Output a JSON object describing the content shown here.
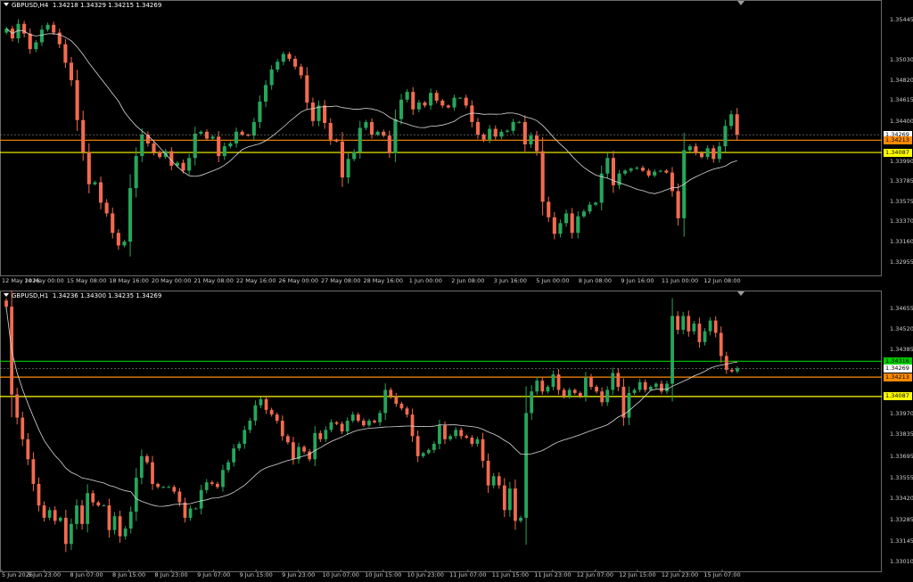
{
  "top_chart": {
    "title": "GBPUSD,H4",
    "ohlc": "1.34218 1.34329 1.34215 1.34269",
    "price_labels": [
      "1.35445",
      "1.35030",
      "1.34820",
      "1.34615",
      "1.34400",
      "1.33990",
      "1.33785",
      "1.33575",
      "1.33370",
      "1.33160",
      "1.32955"
    ],
    "time_labels": [
      "12 May 2026",
      "14 May 00:00",
      "15 May 08:00",
      "18 May 16:00",
      "20 May 00:00",
      "21 May 08:00",
      "22 May 16:00",
      "26 May 00:00",
      "27 May 08:00",
      "28 May 16:00",
      "1 Jun 00:00",
      "2 Jun 08:00",
      "3 Jun 16:00",
      "5 Jun 00:00",
      "8 Jun 08:00",
      "9 Jun 16:00",
      "11 Jun 00:00",
      "12 Jun 08:00"
    ],
    "tags": [
      {
        "value": "1.34269",
        "color": "#ffffff"
      },
      {
        "value": "1.34213",
        "color": "#ff8c00"
      },
      {
        "value": "1.34087",
        "color": "#ffff00"
      }
    ],
    "price_range": [
      1.3285,
      1.356
    ]
  },
  "bottom_chart": {
    "title": "GBPUSD,H1",
    "ohlc": "1.34236 1.34300 1.34235 1.34269",
    "price_labels": [
      "1.34655",
      "1.34520",
      "1.34385",
      "1.33970",
      "1.33835",
      "1.33695",
      "1.33555",
      "1.33420",
      "1.33285",
      "1.33145",
      "1.33010"
    ],
    "time_labels": [
      "5 Jun 2026",
      "5 Jun 23:00",
      "8 Jun 07:00",
      "8 Jun 15:00",
      "8 Jun 23:00",
      "9 Jun 07:00",
      "9 Jun 15:00",
      "9 Jun 23:00",
      "10 Jun 07:00",
      "10 Jun 15:00",
      "10 Jun 23:00",
      "11 Jun 07:00",
      "11 Jun 15:00",
      "11 Jun 23:00",
      "12 Jun 07:00",
      "12 Jun 15:00",
      "12 Jun 23:00",
      "15 Jun 07:00"
    ],
    "tags": [
      {
        "value": "1.34316",
        "color": "#00cc00"
      },
      {
        "value": "1.34269",
        "color": "#ffffff"
      },
      {
        "value": "1.34213",
        "color": "#ff8c00"
      },
      {
        "value": "1.34087",
        "color": "#ffff00"
      }
    ],
    "price_range": [
      1.3297,
      1.3474
    ]
  },
  "colors": {
    "bull": "#26a65b",
    "bear": "#f26b50",
    "ma": "#d8d8d8",
    "orange_line": "#ff8c00",
    "yellow_line": "#ffff00",
    "green_line": "#00cc00",
    "grid_border": "#6b6b6b"
  },
  "chart_data": [
    {
      "type": "candlestick",
      "title": "GBPUSD,H4",
      "ylim": [
        1.3285,
        1.356
      ],
      "series": [
        {
          "name": "GBPUSD,H4",
          "values": [
            1.3536,
            1.3526,
            1.3541,
            1.3531,
            1.3515,
            1.3522,
            1.3535,
            1.354,
            1.3532,
            1.352,
            1.3501,
            1.3483,
            1.3442,
            1.3409,
            1.3376,
            1.3378,
            1.3357,
            1.3346,
            1.3326,
            1.3313,
            1.3317,
            1.3372,
            1.3405,
            1.3427,
            1.3418,
            1.3409,
            1.3404,
            1.341,
            1.3395,
            1.3398,
            1.339,
            1.3403,
            1.3428,
            1.343,
            1.3423,
            1.3425,
            1.3405,
            1.3415,
            1.3418,
            1.343,
            1.3427,
            1.3426,
            1.344,
            1.3461,
            1.3478,
            1.3494,
            1.3502,
            1.351,
            1.3505,
            1.3497,
            1.3488,
            1.346,
            1.3441,
            1.3457,
            1.3439,
            1.3422,
            1.342,
            1.3383,
            1.3402,
            1.3409,
            1.3434,
            1.344,
            1.3427,
            1.343,
            1.3426,
            1.3408,
            1.3443,
            1.3463,
            1.3471,
            1.3453,
            1.346,
            1.3457,
            1.347,
            1.3462,
            1.3457,
            1.3455,
            1.3465,
            1.3465,
            1.3457,
            1.344,
            1.3427,
            1.3422,
            1.3433,
            1.3425,
            1.343,
            1.3431,
            1.344,
            1.344,
            1.3417,
            1.3426,
            1.341,
            1.3358,
            1.3342,
            1.3325,
            1.3336,
            1.3346,
            1.3326,
            1.3343,
            1.3348,
            1.3355,
            1.3357,
            1.3387,
            1.3403,
            1.3375,
            1.3387,
            1.339,
            1.3392,
            1.3393,
            1.339,
            1.3385,
            1.3389,
            1.339,
            1.3388,
            1.3369,
            1.3341,
            1.3411,
            1.3415,
            1.3408,
            1.3404,
            1.3413,
            1.3402,
            1.3415,
            1.3436,
            1.3448,
            1.3427
          ]
        }
      ],
      "reference_lines": [
        1.34213,
        1.34087
      ],
      "last_price": 1.34269
    },
    {
      "type": "candlestick",
      "title": "GBPUSD,H1",
      "ylim": [
        1.3297,
        1.3474
      ],
      "series": [
        {
          "name": "GBPUSD,H1",
          "values": [
            1.3467,
            1.341,
            1.3395,
            1.3381,
            1.3368,
            1.3352,
            1.3338,
            1.333,
            1.3335,
            1.3328,
            1.333,
            1.3313,
            1.3326,
            1.3338,
            1.3326,
            1.3346,
            1.334,
            1.3338,
            1.3338,
            1.3322,
            1.3331,
            1.3318,
            1.3323,
            1.3334,
            1.3356,
            1.337,
            1.3366,
            1.3352,
            1.335,
            1.335,
            1.335,
            1.3347,
            1.334,
            1.333,
            1.3336,
            1.3336,
            1.3348,
            1.3353,
            1.3352,
            1.335,
            1.3361,
            1.3366,
            1.3375,
            1.3378,
            1.3387,
            1.3393,
            1.3403,
            1.3407,
            1.34,
            1.3397,
            1.3393,
            1.3383,
            1.3379,
            1.3368,
            1.3376,
            1.3373,
            1.3368,
            1.3385,
            1.3381,
            1.3387,
            1.3392,
            1.3391,
            1.3386,
            1.3393,
            1.3397,
            1.3393,
            1.339,
            1.3393,
            1.3392,
            1.3398,
            1.3413,
            1.3409,
            1.3404,
            1.3401,
            1.3397,
            1.3383,
            1.337,
            1.3372,
            1.3374,
            1.3378,
            1.339,
            1.3381,
            1.3383,
            1.3387,
            1.3383,
            1.3382,
            1.3378,
            1.3381,
            1.3367,
            1.3351,
            1.3357,
            1.3351,
            1.3335,
            1.3349,
            1.3328,
            1.333,
            1.3398,
            1.3412,
            1.3419,
            1.3412,
            1.3415,
            1.3423,
            1.3413,
            1.3409,
            1.3413,
            1.3411,
            1.3409,
            1.3421,
            1.3415,
            1.3412,
            1.3405,
            1.3413,
            1.3424,
            1.3415,
            1.3395,
            1.3411,
            1.3413,
            1.3418,
            1.3413,
            1.3415,
            1.3417,
            1.3412,
            1.3417,
            1.3461,
            1.3452,
            1.3461,
            1.3451,
            1.3456,
            1.3444,
            1.3451,
            1.3458,
            1.345,
            1.3435,
            1.3426,
            1.3425,
            1.3427
          ]
        }
      ],
      "reference_lines": [
        1.34316,
        1.34213,
        1.34087
      ],
      "last_price": 1.34269
    }
  ]
}
